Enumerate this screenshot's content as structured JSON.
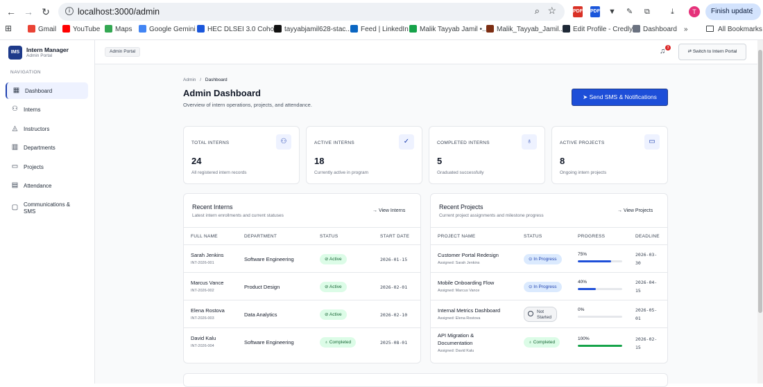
{
  "browser": {
    "url": "localhost:3000/admin",
    "finish_label": "Finish update",
    "profile_initial": "T",
    "bookmarks": [
      {
        "label": "Gmail",
        "color": "#ea4335"
      },
      {
        "label": "YouTube",
        "color": "#ff0000"
      },
      {
        "label": "Maps",
        "color": "#34a853"
      },
      {
        "label": "Google Gemini",
        "color": "#4285f4"
      },
      {
        "label": "HEC DLSEI 3.0 Coho...",
        "color": "#1a56db"
      },
      {
        "label": "tayyabjamil628-stac...",
        "color": "#111111"
      },
      {
        "label": "Feed | LinkedIn",
        "color": "#0a66c2"
      },
      {
        "label": "Malik Tayyab Jamil •...",
        "color": "#16a34a"
      },
      {
        "label": "Malik_Tayyab_Jamil...",
        "color": "#7c2d12"
      },
      {
        "label": "Edit Profile - Credly",
        "color": "#1f2937"
      },
      {
        "label": "Dashboard",
        "color": "#6b7280"
      }
    ],
    "more_label": "»",
    "all_bookmarks": "All Bookmarks"
  },
  "sidebar": {
    "logo": "IMS",
    "title": "Intern Manager",
    "subtitle": "Admin Portal",
    "section": "NAVIGATION",
    "items": [
      {
        "label": "Dashboard",
        "icon": "grid-icon",
        "glyph": "▦"
      },
      {
        "label": "Interns",
        "icon": "users-icon",
        "glyph": "⚇"
      },
      {
        "label": "Instructors",
        "icon": "graduation-cap-icon",
        "glyph": "◬"
      },
      {
        "label": "Departments",
        "icon": "building-icon",
        "glyph": "▥"
      },
      {
        "label": "Projects",
        "icon": "folder-icon",
        "glyph": "▭"
      },
      {
        "label": "Attendance",
        "icon": "calendar-icon",
        "glyph": "▤"
      },
      {
        "label": "Communications & SMS",
        "icon": "message-icon",
        "glyph": "▢"
      }
    ]
  },
  "topbar": {
    "context": "Admin Portal",
    "notification_count": "3",
    "switch_label": "⇄ Switch to Intern Portal"
  },
  "page": {
    "breadcrumb_root": "Admin",
    "breadcrumb_sep": "/",
    "breadcrumb_current": "Dashboard",
    "title": "Admin Dashboard",
    "subtitle": "Overview of intern operations, projects, and attendance.",
    "send_label": "➤ Send SMS & Notifications"
  },
  "stats": [
    {
      "label": "TOTAL INTERNS",
      "value": "24",
      "desc": "All registered intern records",
      "icon": "users-icon",
      "glyph": "⚇"
    },
    {
      "label": "ACTIVE INTERNS",
      "value": "18",
      "desc": "Currently active in program",
      "icon": "user-check-icon",
      "glyph": "✓"
    },
    {
      "label": "COMPLETED INTERNS",
      "value": "5",
      "desc": "Graduated successfully",
      "icon": "award-icon",
      "glyph": "♁"
    },
    {
      "label": "ACTIVE PROJECTS",
      "value": "8",
      "desc": "Ongoing intern projects",
      "icon": "folder-icon",
      "glyph": "▭"
    }
  ],
  "recent_interns": {
    "title": "Recent Interns",
    "subtitle": "Latest intern enrollments and current statuses",
    "view_label": "→  View Interns",
    "columns": [
      "FULL NAME",
      "DEPARTMENT",
      "STATUS",
      "START DATE"
    ],
    "rows": [
      {
        "name": "Sarah Jenkins",
        "id": "INT-2026-001",
        "dept": "Software Engineering",
        "status": "Active",
        "date": "2026-01-15"
      },
      {
        "name": "Marcus Vance",
        "id": "INT-2026-002",
        "dept": "Product Design",
        "status": "Active",
        "date": "2026-02-01"
      },
      {
        "name": "Elena Rostova",
        "id": "INT-2026-003",
        "dept": "Data Analytics",
        "status": "Active",
        "date": "2026-02-10"
      },
      {
        "name": "David Kalu",
        "id": "INT-2026-004",
        "dept": "Software Engineering",
        "status": "Completed",
        "date": "2025-08-01"
      }
    ]
  },
  "recent_projects": {
    "title": "Recent Projects",
    "subtitle": "Current project assignments and milestone progress",
    "view_label": "→  View Projects",
    "columns": [
      "PROJECT NAME",
      "STATUS",
      "PROGRESS",
      "DEADLINE"
    ],
    "rows": [
      {
        "name": "Customer Portal Redesign",
        "assigned": "Assigned: Sarah Jenkins",
        "status": "In Progress",
        "progress_label": "75%",
        "progress": 0.75,
        "bar_color": "#1d4ed8",
        "deadline_a": "2026-03-",
        "deadline_b": "30"
      },
      {
        "name": "Mobile Onboarding Flow",
        "assigned": "Assigned: Marcus Vance",
        "status": "In Progress",
        "progress_label": "40%",
        "progress": 0.4,
        "bar_color": "#1d4ed8",
        "deadline_a": "2026-04-",
        "deadline_b": "15"
      },
      {
        "name": "Internal Metrics Dashboard",
        "assigned": "Assigned: Elena Rostova",
        "status_a": "Not",
        "status_b": "Started",
        "status": "Not Started",
        "progress_label": "0%",
        "progress": 0.0,
        "bar_color": "#1d4ed8",
        "deadline_a": "2026-05-",
        "deadline_b": "01"
      },
      {
        "name_a": "API Migration &",
        "name_b": "Documentation",
        "assigned": "Assigned: David Kalu",
        "status": "Completed",
        "progress_label": "100%",
        "progress": 1.0,
        "bar_color": "#16a34a",
        "deadline_a": "2026-02-",
        "deadline_b": "15"
      }
    ]
  }
}
